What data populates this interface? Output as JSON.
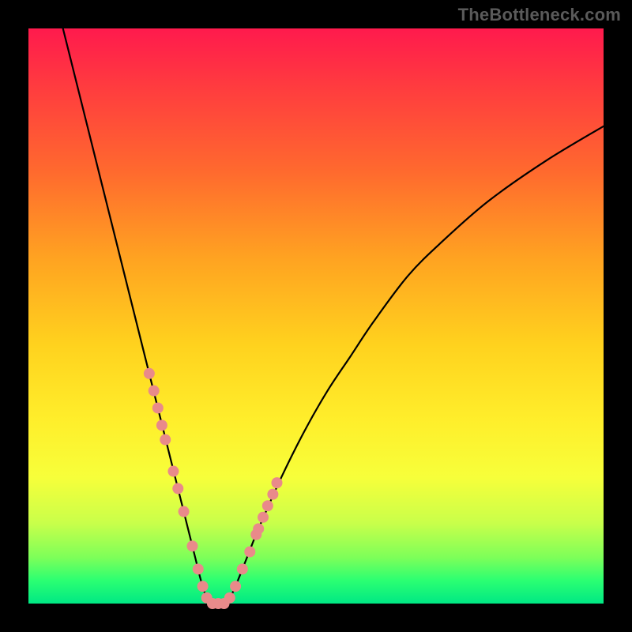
{
  "watermark": "TheBottleneck.com",
  "colors": {
    "curve_stroke": "#000000",
    "marker_fill": "#e98a8a",
    "frame_bg": "#000000"
  },
  "chart_data": {
    "type": "line",
    "title": "",
    "xlabel": "",
    "ylabel": "",
    "xlim": [
      0,
      100
    ],
    "ylim": [
      0,
      100
    ],
    "grid": false,
    "legend": false,
    "series": [
      {
        "name": "bottleneck-curve",
        "x": [
          6,
          8,
          10,
          12,
          14,
          16,
          18,
          20,
          22,
          24,
          25,
          26,
          27,
          28,
          29,
          30,
          31,
          32,
          33,
          34,
          35,
          36,
          38,
          40,
          44,
          48,
          52,
          56,
          60,
          66,
          72,
          80,
          90,
          100
        ],
        "y": [
          100,
          92,
          84,
          76,
          68,
          60,
          52,
          44,
          36,
          28,
          24,
          20,
          16,
          12,
          8,
          4,
          1,
          0,
          0,
          0,
          1,
          3,
          8,
          13,
          22,
          30,
          37,
          43,
          49,
          57,
          63,
          70,
          77,
          83
        ]
      }
    ],
    "markers": {
      "name": "highlight-points",
      "x": [
        21.0,
        21.8,
        22.5,
        23.2,
        23.8,
        25.2,
        26.0,
        27.0,
        28.5,
        29.5,
        30.3,
        31.0,
        32.0,
        33.0,
        34.0,
        35.0,
        36.0,
        37.2,
        38.5,
        39.6,
        40.0,
        40.8,
        41.6,
        42.5,
        43.2
      ],
      "y": [
        40.0,
        37.0,
        34.0,
        31.0,
        28.5,
        23.0,
        20.0,
        16.0,
        10.0,
        6.0,
        3.0,
        1.0,
        0.0,
        0.0,
        0.0,
        1.0,
        3.0,
        6.0,
        9.0,
        12.0,
        13.0,
        15.0,
        17.0,
        19.0,
        21.0
      ],
      "radius": 7
    }
  }
}
